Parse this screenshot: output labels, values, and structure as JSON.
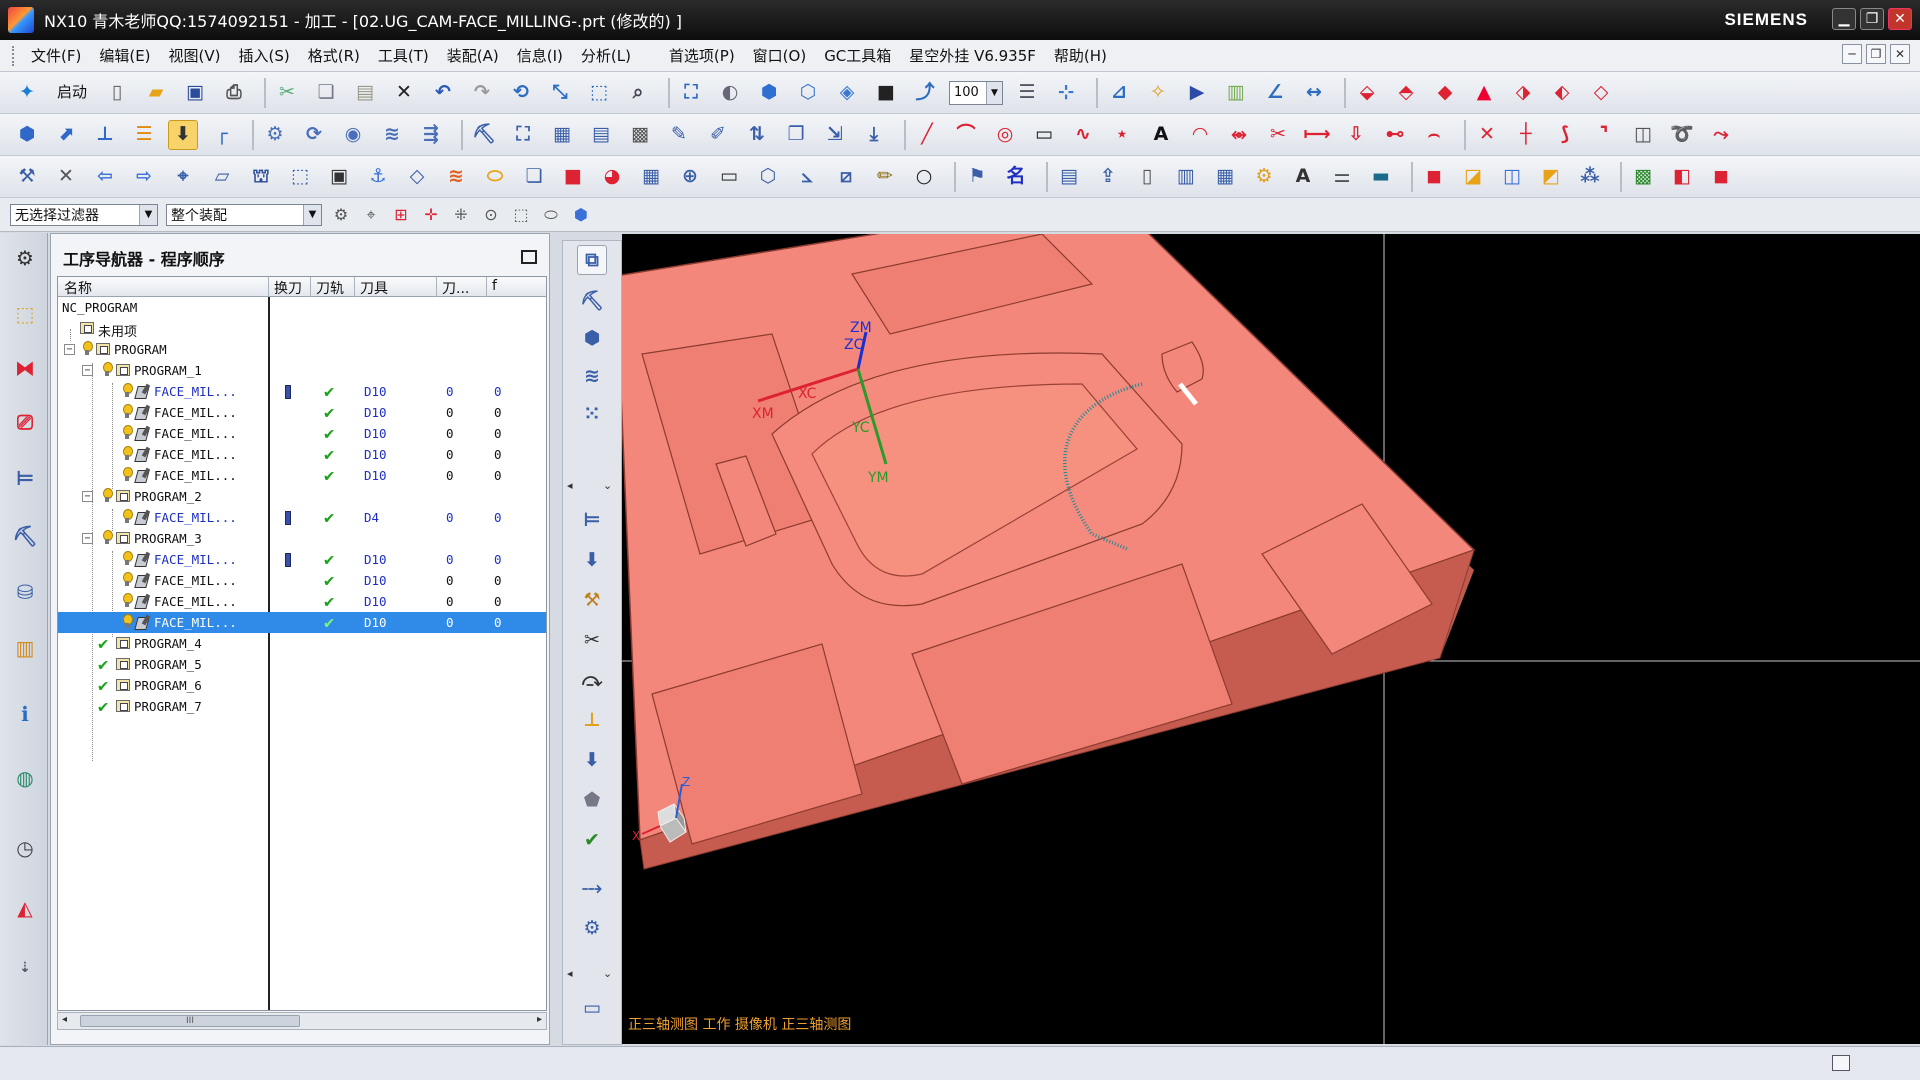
{
  "window": {
    "title": "NX10 青木老师QQ:1574092151 - 加工 - [02.UG_CAM-FACE_MILLING-.prt (修改的) ]",
    "brand": "SIEMENS",
    "min_glyph": "▁",
    "max_glyph": "❐",
    "close_glyph": "✕"
  },
  "menu": {
    "items": [
      "文件(F)",
      "编辑(E)",
      "视图(V)",
      "插入(S)",
      "格式(R)",
      "工具(T)",
      "装配(A)",
      "信息(I)",
      "分析(L)"
    ],
    "items2": [
      "首选项(P)",
      "窗口(O)",
      "GC工具箱",
      "星空外挂 V6.935F",
      "帮助(H)"
    ],
    "mdi_min": "─",
    "mdi_restore": "❐",
    "mdi_close": "✕"
  },
  "toolbar": {
    "start_label": "启动",
    "zoom_value": "100"
  },
  "selection_bar": {
    "filter_value": "无选择过滤器",
    "scope_value": "整个装配"
  },
  "navigator": {
    "title": "工序导航器 - 程序顺序",
    "columns": [
      "名称",
      "换刀",
      "刀轨",
      "刀具",
      "刀...",
      "f"
    ],
    "rows": [
      {
        "name": "NC_PROGRAM",
        "tool": "",
        "n1": "",
        "n2": ""
      },
      {
        "name": "未用项",
        "tool": "",
        "n1": "",
        "n2": ""
      },
      {
        "name": "PROGRAM",
        "tool": "",
        "n1": "",
        "n2": ""
      },
      {
        "name": "PROGRAM_1",
        "tool": "",
        "n1": "",
        "n2": ""
      },
      {
        "name": "FACE_MIL...",
        "tool": "D10",
        "n1": "0",
        "n2": "0"
      },
      {
        "name": "FACE_MIL...",
        "tool": "D10",
        "n1": "0",
        "n2": "0"
      },
      {
        "name": "FACE_MIL...",
        "tool": "D10",
        "n1": "0",
        "n2": "0"
      },
      {
        "name": "FACE_MIL...",
        "tool": "D10",
        "n1": "0",
        "n2": "0"
      },
      {
        "name": "FACE_MIL...",
        "tool": "D10",
        "n1": "0",
        "n2": "0"
      },
      {
        "name": "PROGRAM_2",
        "tool": "",
        "n1": "",
        "n2": ""
      },
      {
        "name": "FACE_MIL...",
        "tool": "D4",
        "n1": "0",
        "n2": "0"
      },
      {
        "name": "PROGRAM_3",
        "tool": "",
        "n1": "",
        "n2": ""
      },
      {
        "name": "FACE_MIL...",
        "tool": "D10",
        "n1": "0",
        "n2": "0"
      },
      {
        "name": "FACE_MIL...",
        "tool": "D10",
        "n1": "0",
        "n2": "0"
      },
      {
        "name": "FACE_MIL...",
        "tool": "D10",
        "n1": "0",
        "n2": "0"
      },
      {
        "name": "FACE_MIL...",
        "tool": "D10",
        "n1": "0",
        "n2": "0"
      },
      {
        "name": "PROGRAM_4",
        "tool": "",
        "n1": "",
        "n2": ""
      },
      {
        "name": "PROGRAM_5",
        "tool": "",
        "n1": "",
        "n2": ""
      },
      {
        "name": "PROGRAM_6",
        "tool": "",
        "n1": "",
        "n2": ""
      },
      {
        "name": "PROGRAM_7",
        "tool": "",
        "n1": "",
        "n2": ""
      }
    ],
    "scroll_thumb": "III"
  },
  "viewport": {
    "axes": {
      "zm": "ZM",
      "zc": "ZC",
      "xm": "XM",
      "xc": "XC",
      "yc": "YC",
      "ym": "YM"
    },
    "triad": {
      "x": "X",
      "z": "Z"
    },
    "view_label": "正三轴测图 工作 摄像机 正三轴测图",
    "part_color": "#f4877b",
    "toolpath_color": "#1f8a96"
  }
}
